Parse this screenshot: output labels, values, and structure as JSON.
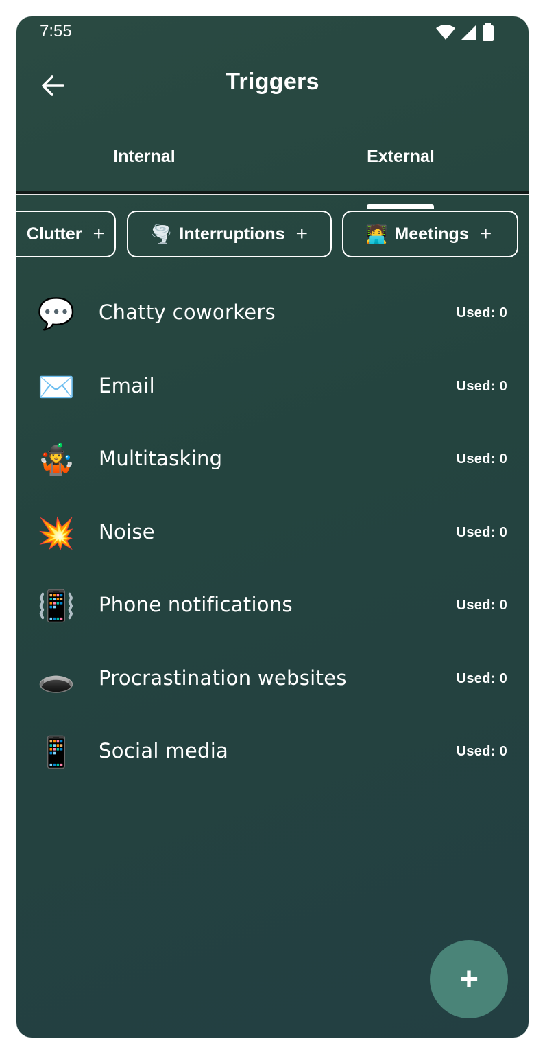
{
  "status_bar": {
    "time": "7:55",
    "icons": [
      "wifi-icon",
      "signal-icon",
      "battery-icon"
    ]
  },
  "header": {
    "title": "Triggers",
    "back_icon": "arrow-left-icon"
  },
  "tabs": [
    {
      "label": "Internal",
      "selected": false
    },
    {
      "label": "External",
      "selected": true
    }
  ],
  "chips": [
    {
      "emoji": "",
      "label": "Clutter",
      "plus": "+"
    },
    {
      "emoji": "🌪️",
      "label": "Interruptions",
      "plus": "+"
    },
    {
      "emoji": "🧑‍💻",
      "label": "Meetings",
      "plus": "+"
    }
  ],
  "triggers": [
    {
      "emoji": "💬",
      "label": "Chatty coworkers",
      "used": "Used: 0"
    },
    {
      "emoji": "✉️",
      "label": "Email",
      "used": "Used: 0"
    },
    {
      "emoji": "🤹",
      "label": "Multitasking",
      "used": "Used: 0"
    },
    {
      "emoji": "💥",
      "label": "Noise",
      "used": "Used: 0"
    },
    {
      "emoji": "📳",
      "label": "Phone notifications",
      "used": "Used: 0"
    },
    {
      "emoji": "🕳️",
      "label": "Procrastination websites",
      "used": "Used: 0"
    },
    {
      "emoji": "📱",
      "label": "Social media",
      "used": "Used: 0"
    }
  ],
  "fab": {
    "label": "+",
    "icon": "plus-icon"
  },
  "colors": {
    "background": "#264641",
    "fab": "#4a8478",
    "text": "#ffffff"
  }
}
